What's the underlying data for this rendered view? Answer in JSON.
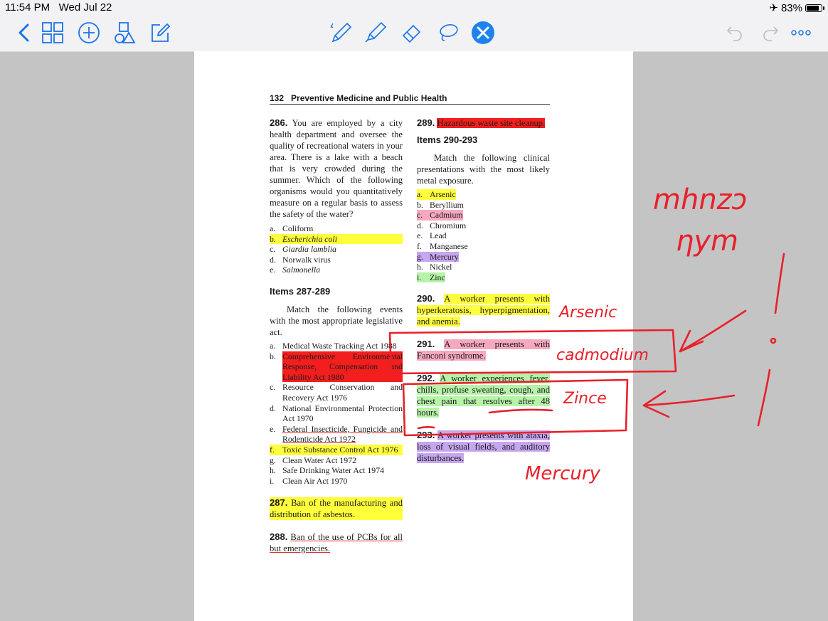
{
  "status": {
    "time": "11:54 PM",
    "date": "Wed Jul 22",
    "battery": "83%",
    "battery_level": 0.83
  },
  "toolbar": {
    "icons": [
      "back-chevron-icon",
      "grid-icon",
      "add-circle-icon",
      "shapes-icon",
      "edit-icon",
      "pen-icon",
      "highlighter-icon",
      "eraser-icon",
      "lasso-icon",
      "close-icon",
      "undo-icon",
      "redo-icon",
      "more-icon"
    ],
    "colors": {
      "accent": "#1a74e8",
      "pen_indicator": "#27b33c",
      "close_bg": "#1e82ee"
    }
  },
  "doc": {
    "header_page": "132",
    "header_title": "Preventive Medicine and Public Health",
    "q286": {
      "num": "286.",
      "text": "You are employed by a city health department and oversee the quality of recreational waters in your area. There is a lake with a beach that is very crowded during the summer. Which of the following organisms would you quantitatively measure on a regular basis to assess the safety of the water?",
      "options": [
        {
          "l": "a.",
          "t": "Coliform"
        },
        {
          "l": "b.",
          "t": "Escherichia coli"
        },
        {
          "l": "c.",
          "t": "Giardia lamblia"
        },
        {
          "l": "d.",
          "t": "Norwalk virus"
        },
        {
          "l": "e.",
          "t": "Salmonella"
        }
      ]
    },
    "items287": {
      "heading": "Items 287-289",
      "intro": "Match the following events with the most appropriate legislative act.",
      "options": [
        {
          "l": "a.",
          "t": "Medical Waste Tracking Act 1988"
        },
        {
          "l": "b.",
          "t": "Comprehensive Environmental Response, Compensation and Liability Act 1980"
        },
        {
          "l": "c.",
          "t": "Resource Conservation and Recovery Act 1976"
        },
        {
          "l": "d.",
          "t": "National Environmental Protection Act 1970"
        },
        {
          "l": "e.",
          "t": "Federal Insecticide, Fungicide and Rodenticide Act 1972"
        },
        {
          "l": "f.",
          "t": "Toxic Substance Control Act 1976"
        },
        {
          "l": "g.",
          "t": "Clean Water Act 1972"
        },
        {
          "l": "h.",
          "t": "Safe Drinking Water Act 1974"
        },
        {
          "l": "i.",
          "t": "Clean Air Act 1970"
        }
      ]
    },
    "q287": {
      "num": "287.",
      "text": "Ban of the manufacturing and distribution of asbestos."
    },
    "q288": {
      "num": "288.",
      "text": "Ban of the use of PCBs for all but emergencies."
    },
    "q289": {
      "num": "289.",
      "text": "Hazardous waste site cleanup."
    },
    "items290": {
      "heading": "Items 290-293",
      "intro": "Match the following clinical presentations with the most likely metal exposure.",
      "options": [
        {
          "l": "a.",
          "t": "Arsenic"
        },
        {
          "l": "b.",
          "t": "Beryllium"
        },
        {
          "l": "c.",
          "t": "Cadmium"
        },
        {
          "l": "d.",
          "t": "Chromium"
        },
        {
          "l": "e.",
          "t": "Lead"
        },
        {
          "l": "f.",
          "t": "Manganese"
        },
        {
          "l": "g.",
          "t": "Mercury"
        },
        {
          "l": "h.",
          "t": "Nickel"
        },
        {
          "l": "i.",
          "t": "Zinc"
        }
      ]
    },
    "q290": {
      "num": "290.",
      "text": "A worker presents with hyperkeratosis, hyperpigmentation, and anemia."
    },
    "q291": {
      "num": "291.",
      "text": "A worker presents with Fanconi syndrome."
    },
    "q292": {
      "num": "292.",
      "text": "A worker experiences fever, chills, profuse sweating, cough, and chest pain that resolves after 48 hours."
    },
    "q293": {
      "num": "293.",
      "text": "A worker presents with ataxia, loss of visual fields, and auditory disturbances."
    }
  },
  "handwriting": {
    "top_note_line1": "mhnzɔ",
    "top_note_line2": "ηym",
    "ans290": "Arsenic",
    "ans291": "cadmodium",
    "ans292": "Zince",
    "ans293": "Mercury",
    "ink_color": "#e8202a"
  }
}
